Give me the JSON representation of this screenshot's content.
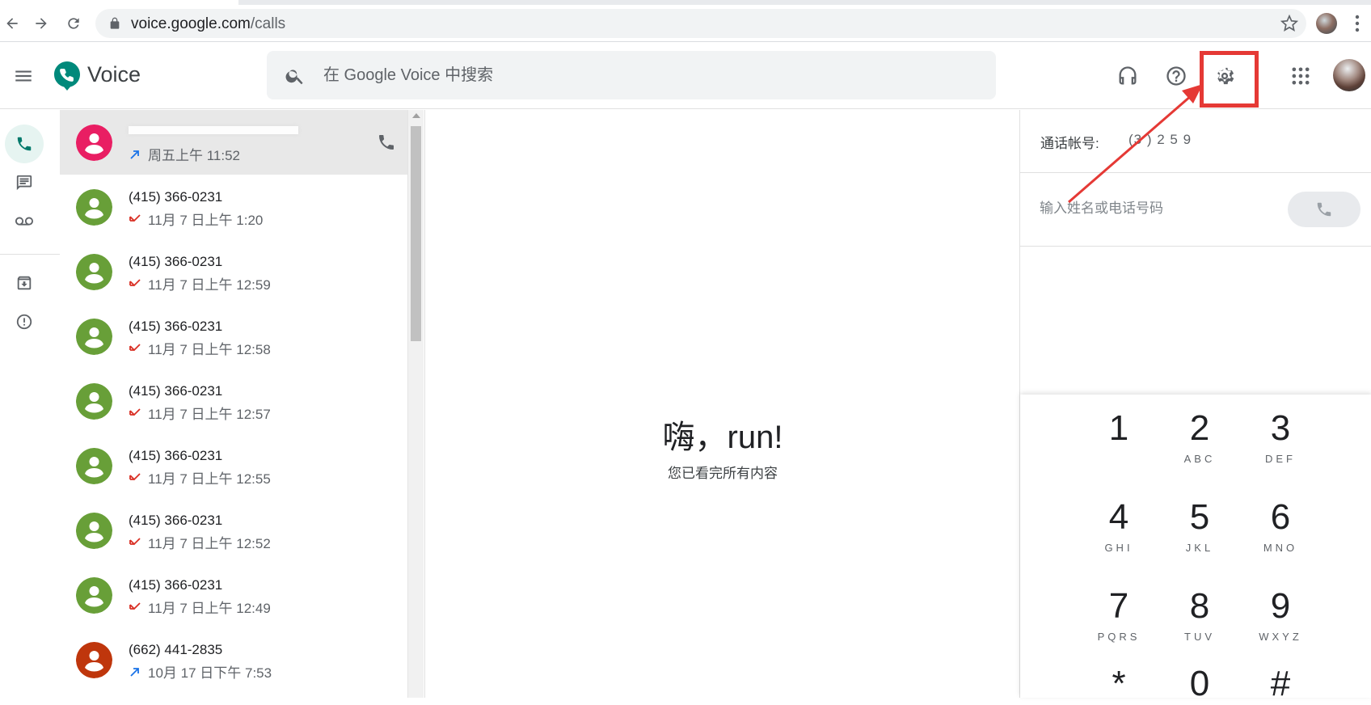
{
  "browser": {
    "url_domain": "voice.google.com",
    "url_path": "/calls"
  },
  "header": {
    "brand": "Voice",
    "search_placeholder": "在 Google Voice 中搜索"
  },
  "calls": [
    {
      "name": "",
      "time": "周五上午 11:52",
      "direction": "outgoing",
      "avatar_color": "#e91e63",
      "redacted": true
    },
    {
      "name": "(415) 366-0231",
      "time": "11月 7 日上午 1:20",
      "direction": "missed",
      "avatar_color": "#689f38"
    },
    {
      "name": "(415) 366-0231",
      "time": "11月 7 日上午 12:59",
      "direction": "missed",
      "avatar_color": "#689f38"
    },
    {
      "name": "(415) 366-0231",
      "time": "11月 7 日上午 12:58",
      "direction": "missed",
      "avatar_color": "#689f38"
    },
    {
      "name": "(415) 366-0231",
      "time": "11月 7 日上午 12:57",
      "direction": "missed",
      "avatar_color": "#689f38"
    },
    {
      "name": "(415) 366-0231",
      "time": "11月 7 日上午 12:55",
      "direction": "missed",
      "avatar_color": "#689f38"
    },
    {
      "name": "(415) 366-0231",
      "time": "11月 7 日上午 12:52",
      "direction": "missed",
      "avatar_color": "#689f38"
    },
    {
      "name": "(415) 366-0231",
      "time": "11月 7 日上午 12:49",
      "direction": "missed",
      "avatar_color": "#689f38"
    },
    {
      "name": "(662) 441-2835",
      "time": "10月 17 日下午 7:53",
      "direction": "outgoing",
      "avatar_color": "#bf360c"
    }
  ],
  "main": {
    "greeting": "嗨，run!",
    "subtitle": "您已看完所有内容"
  },
  "dialer": {
    "account_label": "通话帐号:",
    "account_number": "(3  ) 2   5  9",
    "input_placeholder": "输入姓名或电话号码",
    "keys": [
      {
        "digit": "1",
        "letters": ""
      },
      {
        "digit": "2",
        "letters": "ABC"
      },
      {
        "digit": "3",
        "letters": "DEF"
      },
      {
        "digit": "4",
        "letters": "GHI"
      },
      {
        "digit": "5",
        "letters": "JKL"
      },
      {
        "digit": "6",
        "letters": "MNO"
      },
      {
        "digit": "7",
        "letters": "PQRS"
      },
      {
        "digit": "8",
        "letters": "TUV"
      },
      {
        "digit": "9",
        "letters": "WXYZ"
      },
      {
        "digit": "*",
        "letters": ""
      },
      {
        "digit": "0",
        "letters": ""
      },
      {
        "digit": "#",
        "letters": ""
      }
    ]
  },
  "colors": {
    "accent_teal": "#00796b",
    "missed_red": "#d93025",
    "outgoing_blue": "#1a73e8",
    "annotation_red": "#e53935"
  }
}
